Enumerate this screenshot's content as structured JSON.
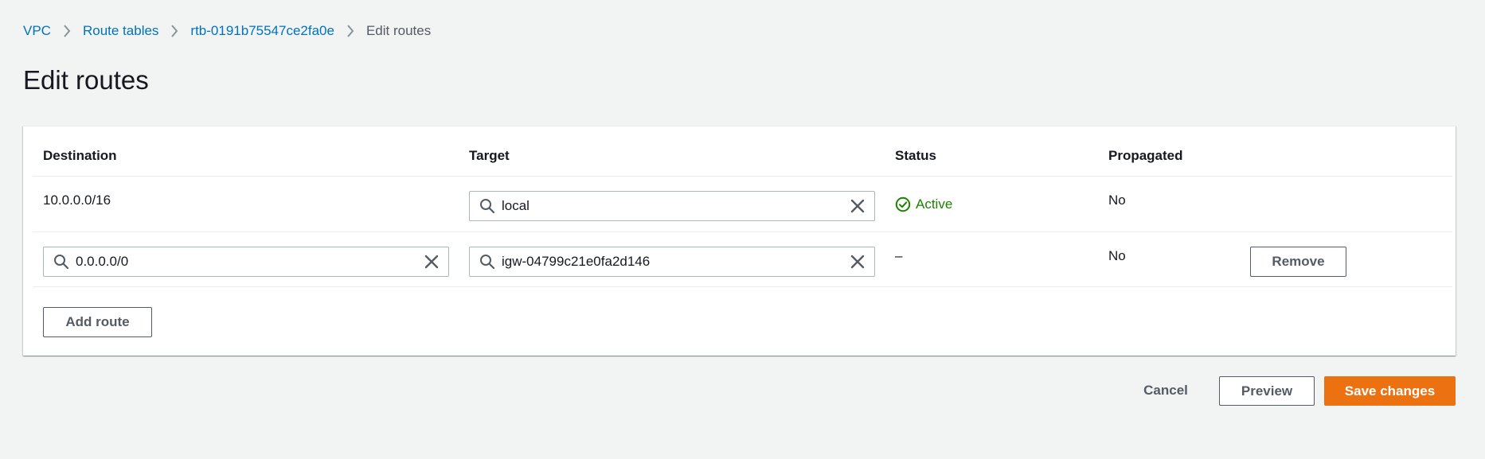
{
  "breadcrumb": {
    "items": [
      {
        "label": "VPC"
      },
      {
        "label": "Route tables"
      },
      {
        "label": "rtb-0191b75547ce2fa0e"
      }
    ],
    "current": "Edit routes"
  },
  "page": {
    "title": "Edit routes"
  },
  "table": {
    "headers": {
      "destination": "Destination",
      "target": "Target",
      "status": "Status",
      "propagated": "Propagated"
    },
    "rows": [
      {
        "destination": "10.0.0.0/16",
        "target": "local",
        "status": "Active",
        "propagated": "No"
      },
      {
        "destination": "0.0.0.0/0",
        "target": "igw-04799c21e0fa2d146",
        "status": "–",
        "propagated": "No",
        "remove_label": "Remove"
      }
    ],
    "add_route_label": "Add route"
  },
  "footer": {
    "cancel_label": "Cancel",
    "preview_label": "Preview",
    "save_label": "Save changes"
  },
  "colors": {
    "link": "#0073bb",
    "success": "#1d8102",
    "primary": "#ec7211",
    "background": "#f2f3f3"
  },
  "icons": {
    "breadcrumb_separator": "chevron-right-icon",
    "search": "search-icon",
    "clear": "close-icon",
    "status": "check-circle-icon"
  }
}
